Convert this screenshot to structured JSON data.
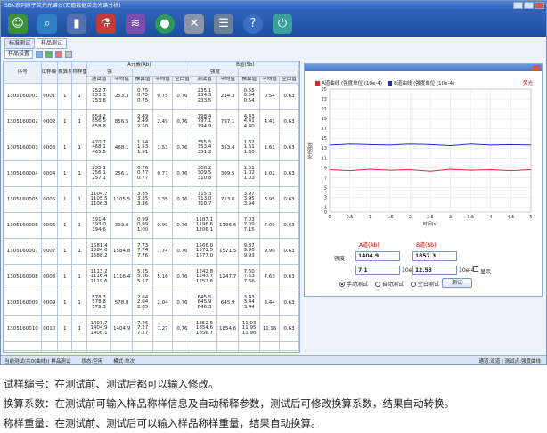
{
  "app": {
    "title": "SBK系列原子荧光光谱仪(双道数据荧光光谱分析)",
    "tabs": [
      "标准测试",
      "样品测试"
    ],
    "active_tab": 1,
    "subbar_label": "样品设置",
    "toolbar_icons": [
      "user-icon",
      "search-icon",
      "signal-icon",
      "flask-icon",
      "chart-icon",
      "circle-icon",
      "tools-icon",
      "database-icon",
      "help-icon",
      "power-icon"
    ]
  },
  "table": {
    "group_a": "A元素(Ab)",
    "group_b": "B道(Sb)",
    "sub_a": "强",
    "sub_b": "强度",
    "col_no": "序号",
    "col_sample": "试样编号",
    "col_conv": "换算系数",
    "col_weight": "称样重量",
    "sub_cols": [
      "测试值",
      "平均值",
      "换算值",
      "平均值",
      "空白值"
    ],
    "rows": [
      {
        "no": "1305160001",
        "sample": "0001",
        "conv": "1",
        "weight": "1",
        "a_vals": [
          "252.7",
          "253.3",
          "253.8"
        ],
        "a_avg": "253.3",
        "a_conv": [
          "0.75",
          "0.75",
          "0.75"
        ],
        "a_avg2": "0.75",
        "a_blank": "0.76",
        "b_vals": [
          "235.1",
          "234.3",
          "233.5"
        ],
        "b_avg": "234.3",
        "b_conv": [
          "0.55",
          "0.54",
          "0.54"
        ],
        "b_avg2": "0.54",
        "b_blank": "0.63"
      },
      {
        "no": "1305160002",
        "sample": "0002",
        "conv": "1",
        "weight": "1",
        "a_vals": [
          "854.2",
          "856.5",
          "858.8"
        ],
        "a_avg": "856.5",
        "a_conv": [
          "2.49",
          "2.49",
          "2.50"
        ],
        "a_avg2": "2.49",
        "a_blank": "0.76",
        "b_vals": [
          "798.4",
          "797.1",
          "794.9"
        ],
        "b_avg": "797.1",
        "b_conv": [
          "4.43",
          "4.41",
          "4.40"
        ],
        "b_avg2": "4.41",
        "b_blank": "0.63"
      },
      {
        "no": "1305160003",
        "sample": "0003",
        "conv": "1",
        "weight": "1",
        "a_vals": [
          "470.7",
          "468.1",
          "465.5"
        ],
        "a_avg": "468.1",
        "a_conv": [
          "1.54",
          "1.53",
          "1.51"
        ],
        "a_avg2": "1.53",
        "a_blank": "0.76",
        "b_vals": [
          "355.5",
          "353.4",
          "351.2"
        ],
        "b_avg": "353.4",
        "b_conv": [
          "1.62",
          "1.61",
          "1.60"
        ],
        "b_avg2": "1.61",
        "b_blank": "0.63"
      },
      {
        "no": "1305160004",
        "sample": "0004",
        "conv": "1",
        "weight": "1",
        "a_vals": [
          "255.1",
          "256.1",
          "257.1"
        ],
        "a_avg": "256.1",
        "a_conv": [
          "0.76",
          "0.77",
          "0.77"
        ],
        "a_avg2": "0.77",
        "a_blank": "0.76",
        "b_vals": [
          "308.2",
          "309.5",
          "310.8"
        ],
        "b_avg": "309.5",
        "b_conv": [
          "1.01",
          "1.02",
          "1.03"
        ],
        "b_avg2": "1.02",
        "b_blank": "0.63"
      },
      {
        "no": "1305160005",
        "sample": "0005",
        "conv": "1",
        "weight": "1",
        "a_vals": [
          "1104.7",
          "1105.5",
          "1106.3"
        ],
        "a_avg": "1105.5",
        "a_conv": [
          "3.35",
          "3.35",
          "3.36"
        ],
        "a_avg2": "3.35",
        "a_blank": "0.76",
        "b_vals": [
          "715.3",
          "713.0",
          "710.7"
        ],
        "b_avg": "713.0",
        "b_conv": [
          "3.97",
          "3.95",
          "3.94"
        ],
        "b_avg2": "3.95",
        "b_blank": "0.63"
      },
      {
        "no": "1305160006",
        "sample": "0006",
        "conv": "1",
        "weight": "1",
        "a_vals": [
          "391.4",
          "393.0",
          "394.6"
        ],
        "a_avg": "393.0",
        "a_conv": [
          "0.99",
          "0.99",
          "1.00"
        ],
        "a_avg2": "0.99",
        "a_blank": "0.76",
        "b_vals": [
          "1187.1",
          "1196.6",
          "1206.1"
        ],
        "b_avg": "1196.6",
        "b_conv": [
          "7.03",
          "7.09",
          "7.15"
        ],
        "b_avg2": "7.09",
        "b_blank": "0.63"
      },
      {
        "no": "1305160007",
        "sample": "0007",
        "conv": "1",
        "weight": "1",
        "a_vals": [
          "1581.4",
          "1584.8",
          "1588.2"
        ],
        "a_avg": "1584.8",
        "a_conv": [
          "7.73",
          "7.74",
          "7.76"
        ],
        "a_avg2": "7.74",
        "a_blank": "0.76",
        "b_vals": [
          "1566.0",
          "1571.5",
          "1577.0"
        ],
        "b_avg": "1571.5",
        "b_conv": [
          "9.87",
          "9.90",
          "9.93"
        ],
        "b_avg2": "9.90",
        "b_blank": "0.63"
      },
      {
        "no": "1305160008",
        "sample": "0008",
        "conv": "1",
        "weight": "1",
        "a_vals": [
          "1113.2",
          "1116.4",
          "1119.6"
        ],
        "a_avg": "1116.4",
        "a_conv": [
          "5.15",
          "5.16",
          "5.17"
        ],
        "a_avg2": "5.16",
        "a_blank": "0.76",
        "b_vals": [
          "1242.8",
          "1247.7",
          "1252.6"
        ],
        "b_avg": "1247.7",
        "b_conv": [
          "7.60",
          "7.63",
          "7.66"
        ],
        "b_avg2": "7.63",
        "b_blank": "0.63"
      },
      {
        "no": "1305160009",
        "sample": "0009",
        "conv": "1",
        "weight": "1",
        "a_vals": [
          "578.3",
          "578.8",
          "579.3"
        ],
        "a_avg": "578.8",
        "a_conv": [
          "2.04",
          "2.04",
          "2.05"
        ],
        "a_avg2": "2.04",
        "a_blank": "0.76",
        "b_vals": [
          "645.5",
          "645.9",
          "646.3"
        ],
        "b_avg": "645.9",
        "b_conv": [
          "3.43",
          "3.44",
          "3.44"
        ],
        "b_avg2": "3.44",
        "b_blank": "0.63"
      },
      {
        "no": "1305160010",
        "sample": "0010",
        "conv": "1",
        "weight": "1",
        "a_vals": [
          "1403.7",
          "1404.9",
          "1406.1"
        ],
        "a_avg": "1404.9",
        "a_conv": [
          "7.26",
          "7.27",
          "7.27"
        ],
        "a_avg2": "7.27",
        "a_blank": "0.76",
        "b_vals": [
          "1852.5",
          "1854.6",
          "1856.7"
        ],
        "b_avg": "1854.6",
        "b_conv": [
          "11.93",
          "11.95",
          "11.96"
        ],
        "b_avg2": "11.95",
        "b_blank": "0.63"
      }
    ]
  },
  "chart_data": {
    "type": "line",
    "legend": [
      "A道曲线 (强度单位 (10e-4)",
      "B道曲线 (强度单位 (10e-4)"
    ],
    "legend_right": "荧光",
    "ylabel": "荧光强度",
    "xlabel": "时间(s)",
    "xlim": [
      0,
      5
    ],
    "ylim": [
      0,
      25
    ],
    "xticks": [
      "0",
      "0.5",
      "1",
      "1.5",
      "2",
      "2.5",
      "3",
      "3.5",
      "4",
      "4.5",
      "5"
    ],
    "yticks": [
      "0",
      "1",
      "3",
      "5",
      "7",
      "9",
      "11",
      "13",
      "15",
      "17",
      "19",
      "21",
      "23",
      "25"
    ],
    "series": [
      {
        "name": "A道曲线",
        "color": "#1f2fbf",
        "x": [
          0,
          0.5,
          1,
          1.5,
          2,
          2.5,
          3,
          3.5,
          4,
          4.5,
          5
        ],
        "y": [
          13.6,
          13.8,
          13.7,
          13.6,
          13.8,
          13.7,
          13.5,
          13.8,
          13.6,
          13.7,
          13.6
        ]
      },
      {
        "name": "B道曲线",
        "color": "#d42a2a",
        "x": [
          0,
          0.5,
          1,
          1.5,
          2,
          2.5,
          3,
          3.5,
          4,
          4.5,
          5
        ],
        "y": [
          8.6,
          8.4,
          8.7,
          8.5,
          8.6,
          8.3,
          8.7,
          8.5,
          8.6,
          8.4,
          8.6
        ]
      }
    ]
  },
  "panel": {
    "a_label": "A道(Ab)",
    "b_label": "B道(Sb)",
    "strength_label": "强度",
    "a_strength": "1404.9",
    "b_strength": "1857.3",
    "a_conc": "7.1",
    "b_conc": "12.53",
    "unit_a": "10e-4",
    "unit_b": "10e-4",
    "check_label": "显示",
    "radios": [
      "手动测试",
      "自动测试",
      "空白测试"
    ],
    "selected_radio": 0,
    "test_button": "测试"
  },
  "status": {
    "left": "当前测试(共0(曲线)) 样品测试",
    "mid": "状态:空闲",
    "mode": "模式:单次",
    "right": "通道:双道 | 测试点:强度曲线"
  },
  "captions": [
    "试样编号：在测试前、测试后都可以输入修改。",
    "换算系数：在测试前可输入样品称样信息及自动稀释参数，测试后可修改换算系数，结果自动转换。",
    "称样重量：在测试前、测试后可以输入样品称样重量，结果自动换算。"
  ]
}
